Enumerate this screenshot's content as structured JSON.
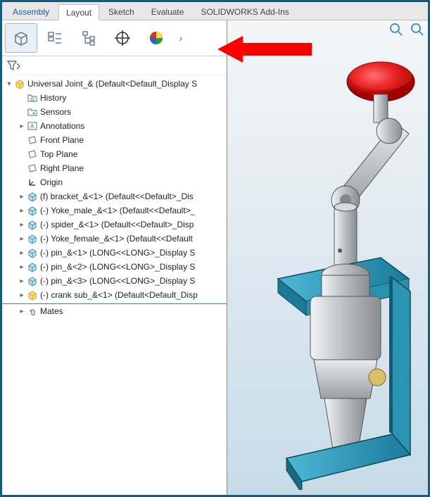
{
  "tabs": {
    "t0": "Assembly",
    "t1": "Layout",
    "t2": "Sketch",
    "t3": "Evaluate",
    "t4": "SOLIDWORKS Add-Ins"
  },
  "tree": {
    "root": "Universal Joint_&  (Default<Default_Display S",
    "history": "History",
    "sensors": "Sensors",
    "annotations": "Annotations",
    "front": "Front Plane",
    "top": "Top Plane",
    "right": "Right Plane",
    "origin": "Origin",
    "c0": "(f) bracket_&<1> (Default<<Default>_Dis",
    "c1": "(-) Yoke_male_&<1> (Default<<Default>_",
    "c2": "(-) spider_&<1> (Default<<Default>_Disp",
    "c3": "(-) Yoke_female_&<1> (Default<<Default",
    "c4": "(-) pin_&<1> (LONG<<LONG>_Display S",
    "c5": "(-) pin_&<2> (LONG<<LONG>_Display S",
    "c6": "(-) pin_&<3> (LONG<<LONG>_Display S",
    "c7": "(-) crank sub_&<1> (Default<Default_Disp",
    "mates": "Mates"
  }
}
